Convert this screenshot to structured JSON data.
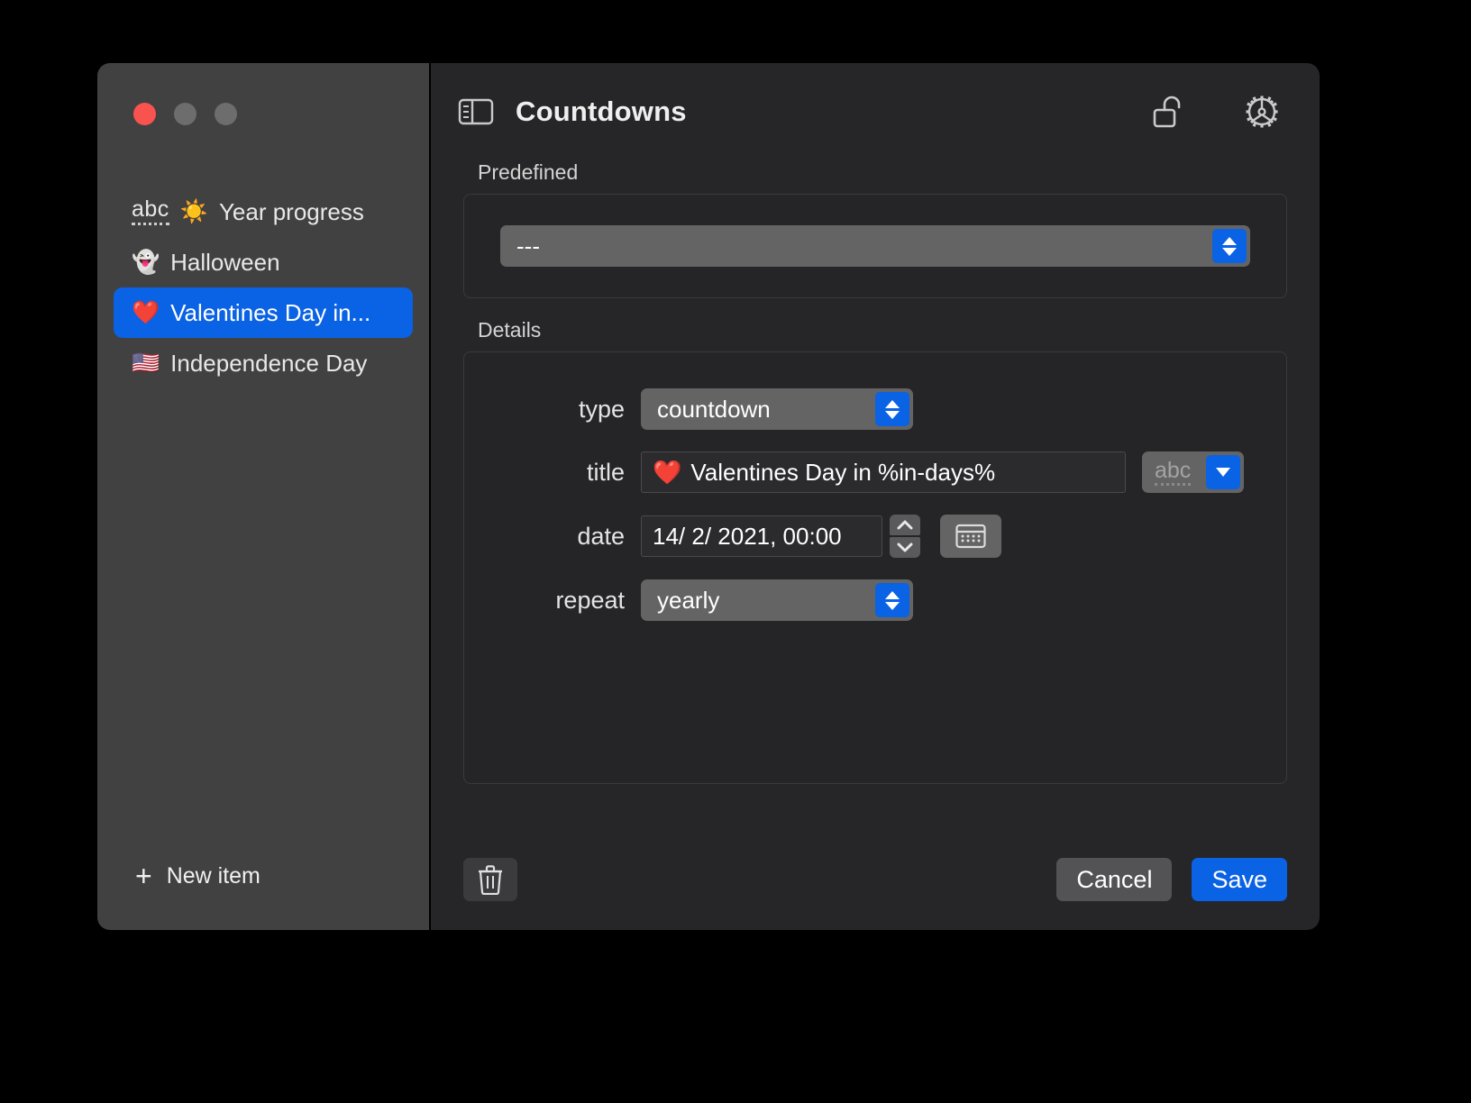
{
  "window": {
    "traffic_lights": [
      "close",
      "minimize",
      "zoom"
    ]
  },
  "sidebar": {
    "items": [
      {
        "emoji": "",
        "label": "Year progress",
        "prefix_badge": "abc",
        "badge_emoji": "☀️",
        "selected": false
      },
      {
        "emoji": "👻",
        "label": "Halloween",
        "selected": false
      },
      {
        "emoji": "❤️",
        "label": "Valentines Day in...",
        "selected": true
      },
      {
        "emoji": "🇺🇸",
        "label": "Independence Day",
        "selected": false
      }
    ],
    "new_item_label": "New item",
    "new_item_icon": "plus-icon"
  },
  "header": {
    "title": "Countdowns",
    "sidebar_toggle_icon": "sidebar-toggle-icon",
    "lock_icon": "unlocked-padlock-icon",
    "settings_icon": "gear-icon"
  },
  "predefined": {
    "group_label": "Predefined",
    "select_value": "---"
  },
  "details": {
    "group_label": "Details",
    "rows": {
      "type": {
        "label": "type",
        "value": "countdown"
      },
      "title": {
        "label": "title",
        "emoji": "❤️",
        "value": "Valentines Day in %in-days%",
        "side_button": "abc"
      },
      "date": {
        "label": "date",
        "value": "14/ 2/ 2021, 00:00",
        "stepper_icon": "stepper-icon",
        "calendar_icon": "calendar-icon"
      },
      "repeat": {
        "label": "repeat",
        "value": "yearly"
      }
    }
  },
  "footer": {
    "delete_icon": "trash-icon",
    "cancel_label": "Cancel",
    "save_label": "Save"
  },
  "colors": {
    "accent": "#0a62e4",
    "window_bg": "#262628",
    "sidebar_bg": "#414141",
    "close_red": "#f9534f"
  }
}
